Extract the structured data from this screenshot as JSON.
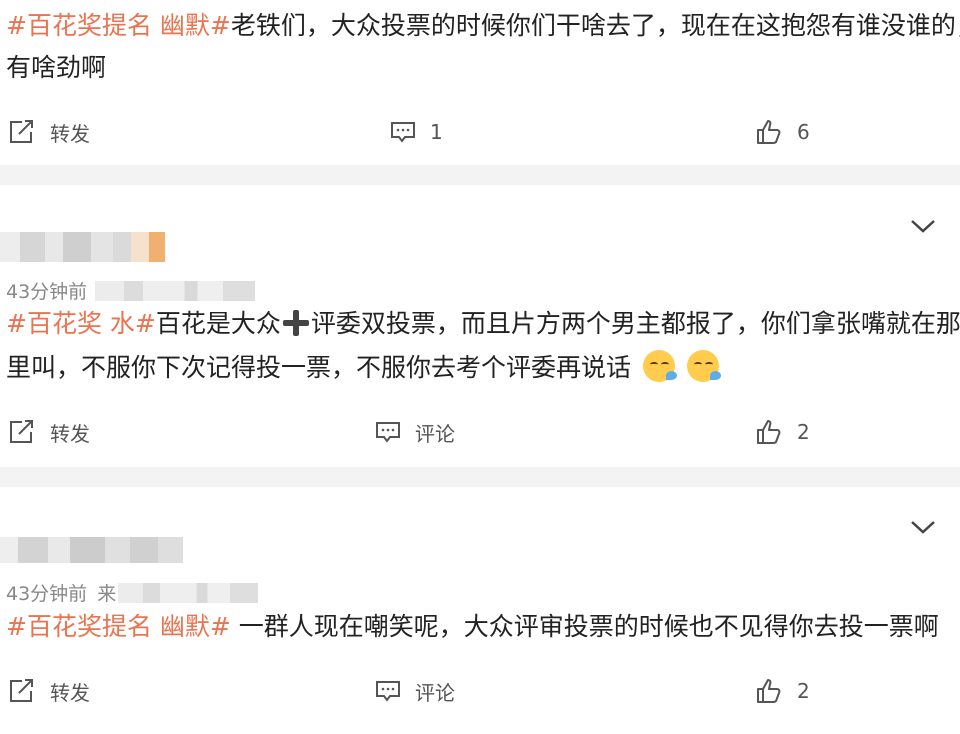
{
  "posts": [
    {
      "tag1": "#百花奖提名",
      "tag2": "幽默#",
      "text_line1": "老铁们，大众投票的时候你们干啥去了，现在在这抱怨有谁没谁的，",
      "text_line2": "有啥劲啊",
      "repost_label": "转发",
      "comment_count": "1",
      "like_count": "6"
    },
    {
      "time": "43分钟前",
      "tag1": "#百花奖",
      "tag2": "水#",
      "text_a": "百花是大众",
      "text_b": "评委双投票，而且片方两个男主都报了，你们拿张嘴就在那",
      "text_line2": "里叫，不服你下次记得投一票，不服你去考个评委再说话",
      "repost_label": "转发",
      "comment_label": "评论",
      "like_count": "2"
    },
    {
      "time": "43分钟前",
      "source_prefix": "来",
      "tag1": "#百花奖提名",
      "tag2": "幽默#",
      "text_line1": " 一群人现在嘲笑呢，大众评审投票的时候也不见得你去投一票啊",
      "repost_label": "转发",
      "comment_label": "评论",
      "like_count": "2"
    }
  ],
  "icons": {
    "repost": "repost-icon",
    "comment": "comment-icon",
    "like": "thumbs-up-icon",
    "more": "chevron-down-icon",
    "emoji": "sleepy-face-emoji"
  },
  "colors": {
    "tag": "#eb7350",
    "background": "#f3f3f3",
    "card": "#ffffff"
  }
}
